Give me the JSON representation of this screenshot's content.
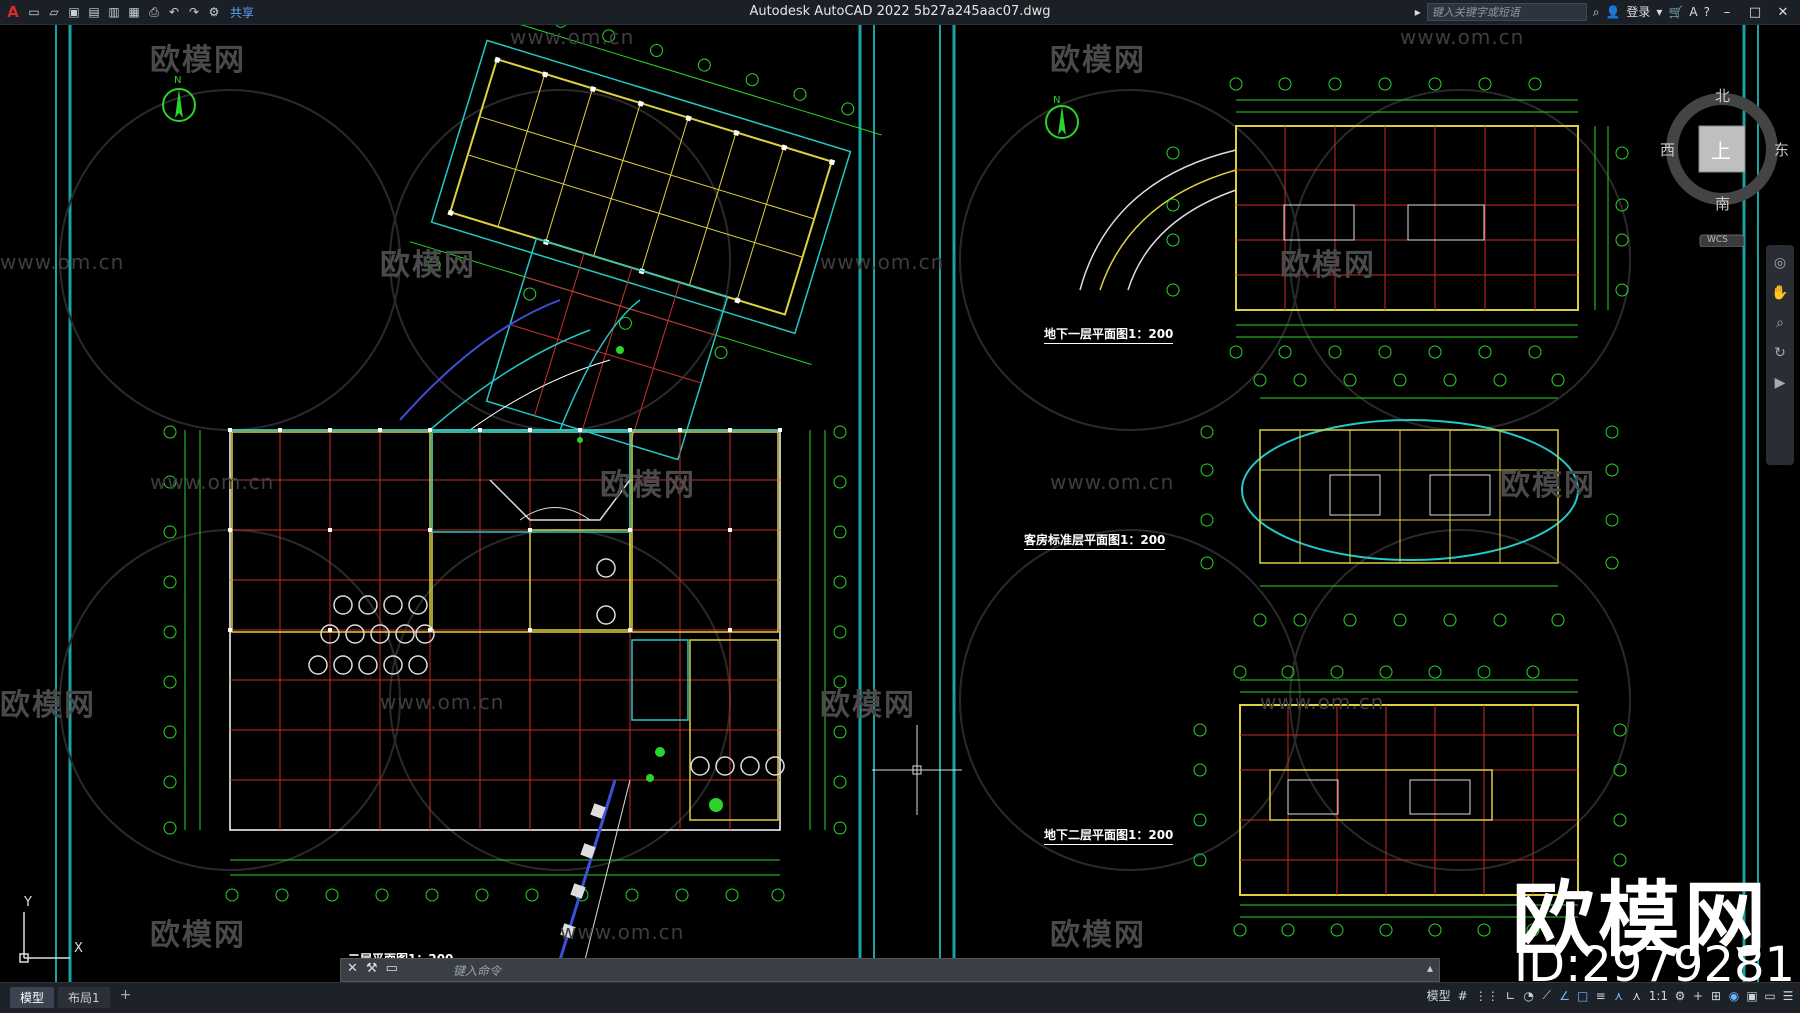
{
  "app": {
    "window_title": "Autodesk AutoCAD 2022    5b27a245aac07.dwg",
    "share_label": "共享",
    "search_placeholder": "键入关键字或短语",
    "login_label": "登录"
  },
  "quick_access": [
    "new-icon",
    "open-icon",
    "save-icon",
    "saveas-icon",
    "open-web-icon",
    "save-web-icon",
    "plot-icon",
    "undo-icon",
    "redo-icon",
    "workspace-icon"
  ],
  "viewcube": {
    "north": "北",
    "south": "南",
    "east": "东",
    "west": "西",
    "face": "上",
    "wcs": "WCS"
  },
  "compass_n": "N",
  "drawing_labels": {
    "basement1": "地下一层平面图1：200",
    "typical_floor": "客房标准层平面图1：200",
    "basement2": "地下二层平面图1：200",
    "floor2": "二层平面图1：200"
  },
  "watermark": {
    "brand": "欧模网",
    "url": "www.om.cn",
    "big_brand": "欧模网",
    "id": "ID:2979281"
  },
  "command_line": {
    "placeholder": "键入命令"
  },
  "status": {
    "tabs": [
      {
        "label": "模型",
        "active": true
      },
      {
        "label": "布局1",
        "active": false
      }
    ],
    "add_tab": "+",
    "mode_label": "模型",
    "scale": "1:1"
  },
  "ucs": {
    "x": "X",
    "y": "Y"
  }
}
